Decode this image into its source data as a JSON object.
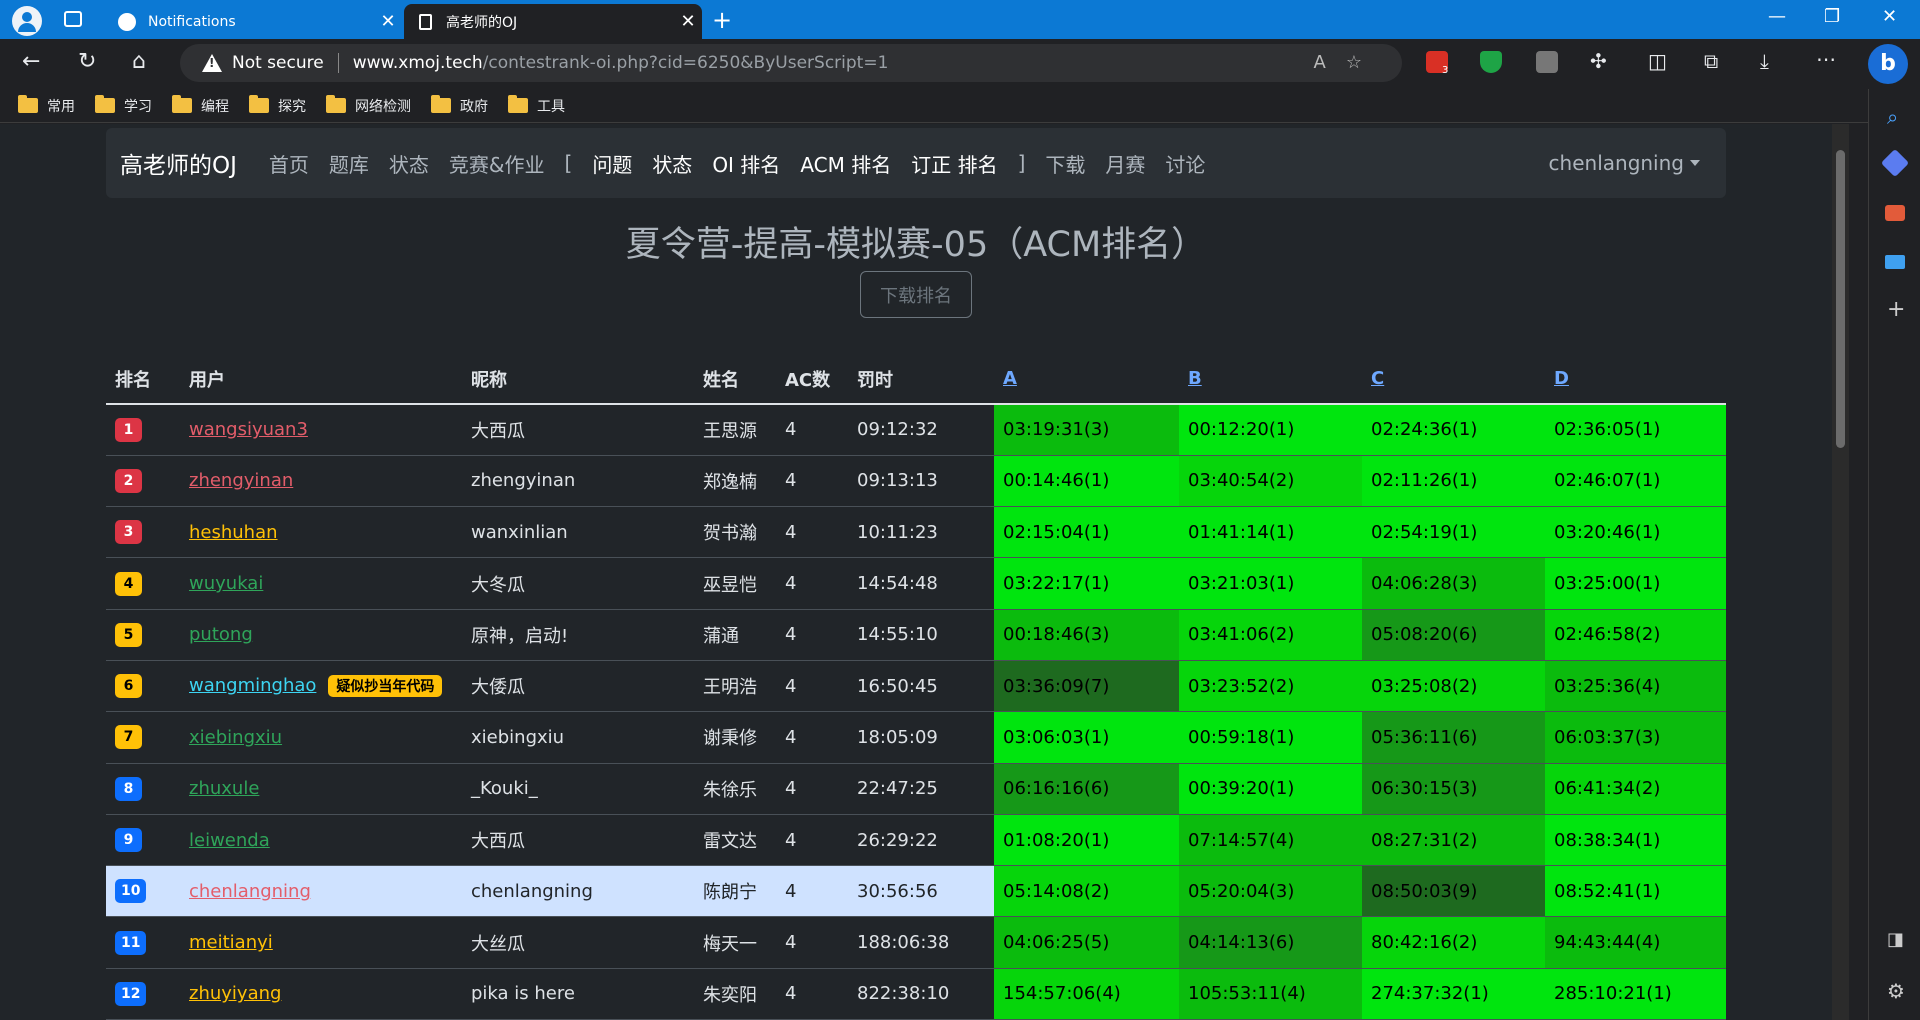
{
  "browser": {
    "tabs": [
      {
        "title": "Notifications",
        "icon": "github-icon"
      },
      {
        "title": "高老师的OJ",
        "icon": "page-icon"
      }
    ],
    "security_label": "Not secure",
    "url_host": "www.xmoj.tech",
    "url_path": "/contestrank-oi.php?cid=6250&ByUserScript=1",
    "extension_badge": "3",
    "bookmarks": [
      "常用",
      "学习",
      "编程",
      "探究",
      "网络检测",
      "政府",
      "工具"
    ]
  },
  "navbar": {
    "brand": "高老师的OJ",
    "links": [
      "首页",
      "题库",
      "状态",
      "竞赛&作业"
    ],
    "bracket_open": "[",
    "contest_links": [
      "问题",
      "状态",
      "OI 排名",
      "ACM 排名",
      "订正 排名"
    ],
    "bracket_close": "]",
    "extra_links": [
      "下载",
      "月赛",
      "讨论"
    ],
    "user": "chenlangning"
  },
  "page": {
    "title": "夏令营-提高-模拟赛-05（ACM排名）",
    "download_button": "下载排名"
  },
  "table": {
    "headers": [
      "排名",
      "用户",
      "昵称",
      "姓名",
      "AC数",
      "罚时"
    ],
    "problems": [
      "A",
      "B",
      "C",
      "D"
    ],
    "rows": [
      {
        "rank": "1",
        "user": "wangsiyuan3",
        "nick": "大西瓜",
        "name": "王思源",
        "ac": "4",
        "penalty": "09:12:32",
        "cells": [
          "03:19:31(3)",
          "00:12:20(1)",
          "02:24:36(1)",
          "02:36:05(1)"
        ]
      },
      {
        "rank": "2",
        "user": "zhengyinan",
        "nick": "zhengyinan",
        "name": "郑逸楠",
        "ac": "4",
        "penalty": "09:13:13",
        "cells": [
          "00:14:46(1)",
          "03:40:54(2)",
          "02:11:26(1)",
          "02:46:07(1)"
        ]
      },
      {
        "rank": "3",
        "user": "heshuhan",
        "nick": "wanxinlian",
        "name": "贺书瀚",
        "ac": "4",
        "penalty": "10:11:23",
        "cells": [
          "02:15:04(1)",
          "01:41:14(1)",
          "02:54:19(1)",
          "03:20:46(1)"
        ]
      },
      {
        "rank": "4",
        "user": "wuyukai",
        "nick": "大冬瓜",
        "name": "巫昱恺",
        "ac": "4",
        "penalty": "14:54:48",
        "cells": [
          "03:22:17(1)",
          "03:21:03(1)",
          "04:06:28(3)",
          "03:25:00(1)"
        ]
      },
      {
        "rank": "5",
        "user": "putong",
        "nick": "原神，启动!",
        "name": "蒲通",
        "ac": "4",
        "penalty": "14:55:10",
        "cells": [
          "00:18:46(3)",
          "03:41:06(2)",
          "05:08:20(6)",
          "02:46:58(2)"
        ]
      },
      {
        "rank": "6",
        "user": "wangminghao",
        "tag": "疑似抄当年代码",
        "nick": "大倭瓜",
        "name": "王明浩",
        "ac": "4",
        "penalty": "16:50:45",
        "cells": [
          "03:36:09(7)",
          "03:23:52(2)",
          "03:25:08(2)",
          "03:25:36(4)"
        ]
      },
      {
        "rank": "7",
        "user": "xiebingxiu",
        "nick": "xiebingxiu",
        "name": "谢秉修",
        "ac": "4",
        "penalty": "18:05:09",
        "cells": [
          "03:06:03(1)",
          "00:59:18(1)",
          "05:36:11(6)",
          "06:03:37(3)"
        ]
      },
      {
        "rank": "8",
        "user": "zhuxule",
        "nick": "_Kouki_",
        "name": "朱徐乐",
        "ac": "4",
        "penalty": "22:47:25",
        "cells": [
          "06:16:16(6)",
          "00:39:20(1)",
          "06:30:15(3)",
          "06:41:34(2)"
        ]
      },
      {
        "rank": "9",
        "user": "leiwenda",
        "nick": "大西瓜",
        "name": "雷文达",
        "ac": "4",
        "penalty": "26:29:22",
        "cells": [
          "01:08:20(1)",
          "07:14:57(4)",
          "08:27:31(2)",
          "08:38:34(1)"
        ]
      },
      {
        "rank": "10",
        "user": "chenlangning",
        "nick": "chenlangning",
        "name": "陈朗宁",
        "ac": "4",
        "penalty": "30:56:56",
        "cells": [
          "05:14:08(2)",
          "05:20:04(3)",
          "08:50:03(9)",
          "08:52:41(1)"
        ]
      },
      {
        "rank": "11",
        "user": "meitianyi",
        "nick": "大丝瓜",
        "name": "梅天一",
        "ac": "4",
        "penalty": "188:06:38",
        "cells": [
          "04:06:25(5)",
          "04:14:13(6)",
          "80:42:16(2)",
          "94:43:44(4)"
        ]
      },
      {
        "rank": "12",
        "user": "zhuyiyang",
        "nick": "pika is here",
        "name": "朱奕阳",
        "ac": "4",
        "penalty": "822:38:10",
        "cells": [
          "154:57:06(4)",
          "105:53:11(4)",
          "274:37:32(1)",
          "285:10:21(1)"
        ]
      }
    ]
  }
}
